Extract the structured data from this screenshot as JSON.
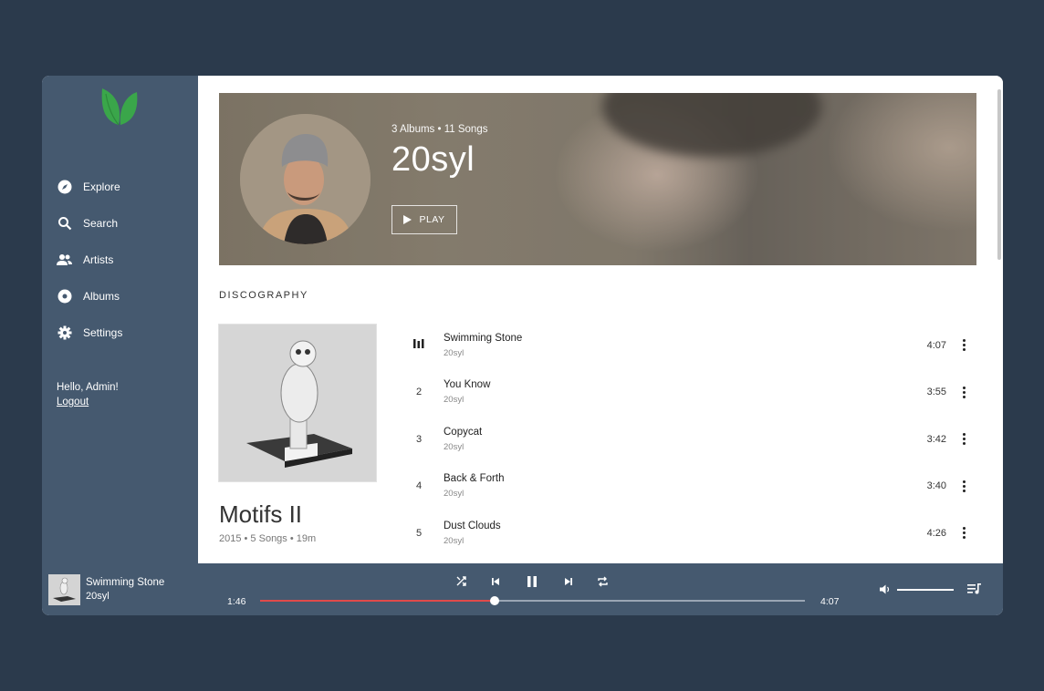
{
  "sidebar": {
    "nav": [
      {
        "label": "Explore",
        "icon": "compass-icon"
      },
      {
        "label": "Search",
        "icon": "search-icon"
      },
      {
        "label": "Artists",
        "icon": "people-icon"
      },
      {
        "label": "Albums",
        "icon": "disc-icon"
      },
      {
        "label": "Settings",
        "icon": "gear-icon"
      }
    ],
    "greeting": "Hello, Admin!",
    "logout": "Logout"
  },
  "artist": {
    "subtitle": "3 Albums • 11 Songs",
    "name": "20syl",
    "play_label": "PLAY"
  },
  "discography": {
    "title": "DISCOGRAPHY",
    "album": {
      "title": "Motifs II",
      "meta": "2015  •  5 Songs  •  19m"
    },
    "tracks": [
      {
        "num": "",
        "name": "Swimming Stone",
        "artist": "20syl",
        "duration": "4:07",
        "playing": true
      },
      {
        "num": "2",
        "name": "You Know",
        "artist": "20syl",
        "duration": "3:55"
      },
      {
        "num": "3",
        "name": "Copycat",
        "artist": "20syl",
        "duration": "3:42"
      },
      {
        "num": "4",
        "name": "Back & Forth",
        "artist": "20syl",
        "duration": "3:40"
      },
      {
        "num": "5",
        "name": "Dust Clouds",
        "artist": "20syl",
        "duration": "4:26"
      }
    ]
  },
  "player": {
    "title": "Swimming Stone",
    "artist": "20syl",
    "elapsed": "1:46",
    "total": "4:07",
    "progress": 0.43,
    "volume": 1.0
  },
  "colors": {
    "sidebar_bg": "#45596f",
    "page_bg": "#2b3a4c",
    "accent_green": "#3aa64a",
    "progress_red": "#e04a4a"
  }
}
